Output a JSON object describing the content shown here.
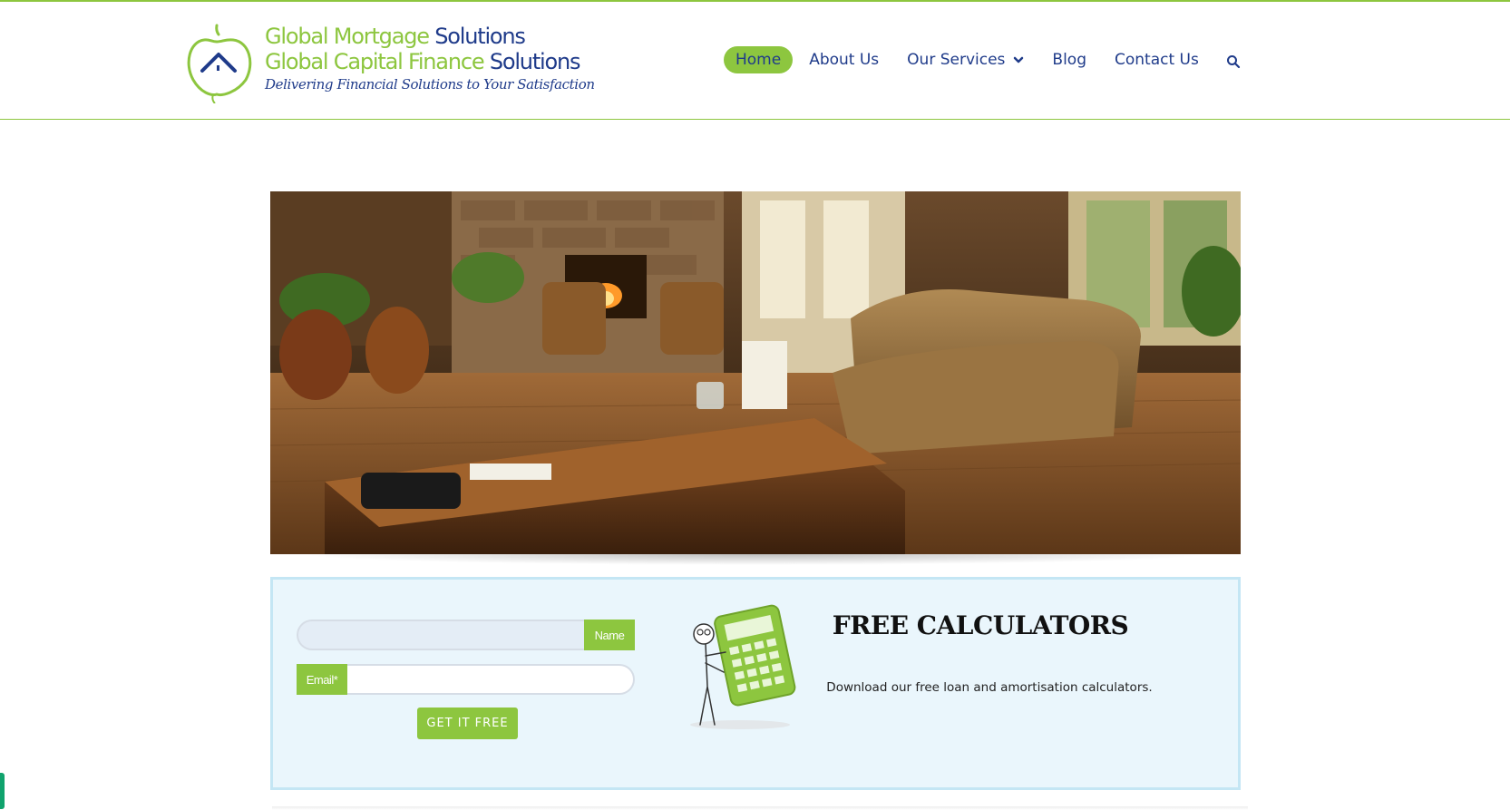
{
  "brand": {
    "line1_green": "Global Mortgage",
    "line1_blue": " Solutions",
    "line2_green": "Global Capital Finance",
    "line2_blue": " Solutions",
    "tagline": "Delivering Financial Solutions to Your Satisfaction",
    "logo_icon": "house-apple-icon",
    "green": "#8dc63f",
    "blue": "#1f3b8a"
  },
  "nav": {
    "items": [
      {
        "label": "Home",
        "active": true
      },
      {
        "label": "About Us"
      },
      {
        "label": "Our Services",
        "has_dropdown": true
      },
      {
        "label": "Blog"
      },
      {
        "label": "Contact Us"
      }
    ],
    "search_icon": "search-icon"
  },
  "hero": {
    "image": "living-room-with-wooden-desk-and-wicker-sofa"
  },
  "optin": {
    "name_label": "Name",
    "name_value": "",
    "email_label": "Email*",
    "email_value": "",
    "button_label": "GET IT FREE"
  },
  "calculators": {
    "illustration": "stick-figure-holding-calculator-illustration",
    "title": "FREE CALCULATORS",
    "description": "Download our free loan and amortisation calculators."
  }
}
